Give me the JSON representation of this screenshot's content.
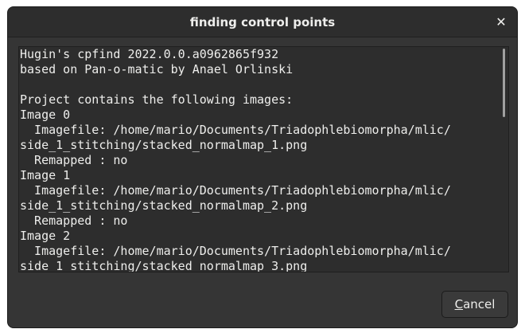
{
  "window": {
    "title": "finding control points",
    "close_icon": "close-icon"
  },
  "log": {
    "lines": [
      "Hugin's cpfind 2022.0.0.a0962865f932",
      "based on Pan-o-matic by Anael Orlinski",
      "",
      "Project contains the following images:",
      "Image 0",
      "  Imagefile: /home/mario/Documents/Triadophlebiomorpha/mlic/",
      "side_1_stitching/stacked_normalmap_1.png",
      "  Remapped : no",
      "Image 1",
      "  Imagefile: /home/mario/Documents/Triadophlebiomorpha/mlic/",
      "side_1_stitching/stacked_normalmap_2.png",
      "  Remapped : no",
      "Image 2",
      "  Imagefile: /home/mario/Documents/Triadophlebiomorpha/mlic/",
      "side_1_stitching/stacked_normalmap_3.png"
    ]
  },
  "buttons": {
    "cancel_mnemonic": "C",
    "cancel_rest": "ancel"
  },
  "colors": {
    "dialog_bg": "#353535",
    "text": "#eeeeec",
    "log_bg": "#2d2d2d"
  }
}
